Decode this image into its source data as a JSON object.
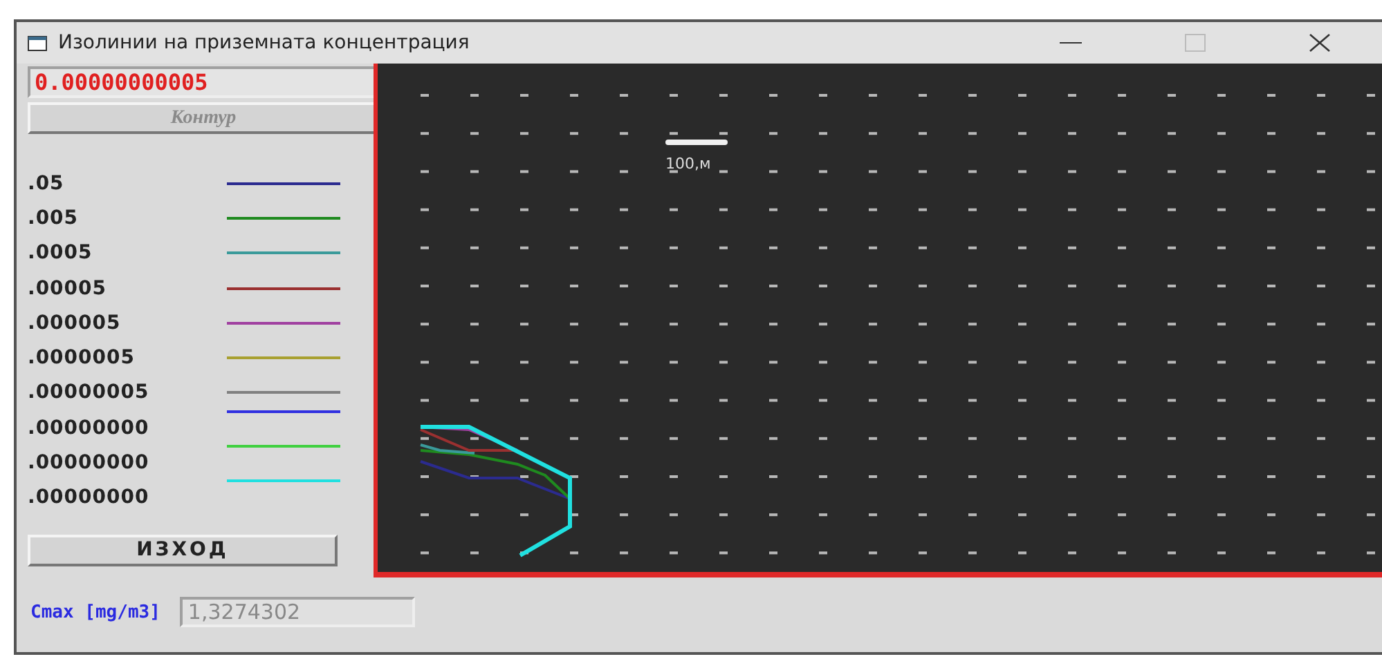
{
  "window": {
    "title": "Изолинии на приземната концентрация"
  },
  "value_field": {
    "value": "0.00000000005"
  },
  "contour_button": {
    "label": "Контур",
    "disabled": true
  },
  "legend": [
    {
      "label": ".05",
      "color": "#2b2b8f",
      "kind": "aligned"
    },
    {
      "label": ".005",
      "color": "#1f8a1f",
      "kind": "aligned"
    },
    {
      "label": ".0005",
      "color": "#3a9a9a",
      "kind": "aligned"
    },
    {
      "label": ".00005",
      "color": "#9a3030",
      "kind": "aligned"
    },
    {
      "label": ".000005",
      "color": "#a040a0",
      "kind": "aligned"
    },
    {
      "label": ".0000005",
      "color": "#a8a030",
      "kind": "aligned"
    },
    {
      "label": ".00000005",
      "color": "#808080",
      "kind": "aligned"
    },
    {
      "label": ".00000000",
      "color": "#3030e0",
      "kind": "raised"
    },
    {
      "label": ".00000000",
      "color": "#40d040",
      "kind": "raised"
    },
    {
      "label": ".00000000",
      "color": "#20e0e0",
      "kind": "raised"
    }
  ],
  "exit_button": {
    "label": "ИЗХОД"
  },
  "plot": {
    "scale_label": "100,м"
  },
  "cmax": {
    "label": "Cmax [mg/m3]",
    "value": "1,3274302",
    "disabled": true
  }
}
